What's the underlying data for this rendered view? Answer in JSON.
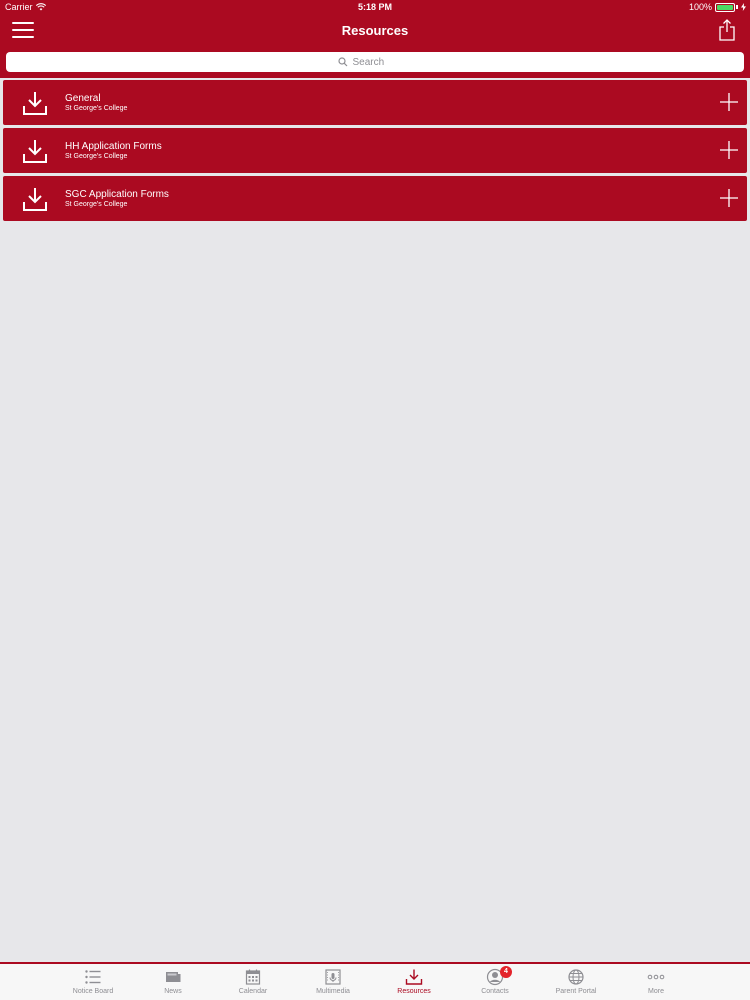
{
  "status": {
    "carrier": "Carrier",
    "time": "5:18 PM",
    "battery": "100%"
  },
  "header": {
    "title": "Resources",
    "menu_icon": "hamburger-menu-icon",
    "share_icon": "share-icon"
  },
  "search": {
    "placeholder": "Search",
    "value": ""
  },
  "resources": [
    {
      "title": "General",
      "subtitle": "St George's College",
      "icon": "download-icon",
      "action_icon": "plus-icon"
    },
    {
      "title": "HH Application Forms",
      "subtitle": "St George's College",
      "icon": "download-icon",
      "action_icon": "plus-icon"
    },
    {
      "title": "SGC Application Forms",
      "subtitle": "St George's College",
      "icon": "download-icon",
      "action_icon": "plus-icon"
    }
  ],
  "tabs": [
    {
      "label": "Notice Board",
      "icon": "list-icon"
    },
    {
      "label": "News",
      "icon": "newspaper-icon"
    },
    {
      "label": "Calendar",
      "icon": "calendar-icon"
    },
    {
      "label": "Multimedia",
      "icon": "multimedia-icon"
    },
    {
      "label": "Resources",
      "icon": "download-icon",
      "active": true
    },
    {
      "label": "Contacts",
      "icon": "contacts-icon",
      "badge": "4"
    },
    {
      "label": "Parent Portal",
      "icon": "globe-icon"
    },
    {
      "label": "More",
      "icon": "more-icon"
    }
  ],
  "colors": {
    "brand": "#ab0a21",
    "background": "#e7e7ea",
    "tab_inactive": "#8e8e93",
    "badge": "#e3242b",
    "battery": "#4cd964"
  }
}
